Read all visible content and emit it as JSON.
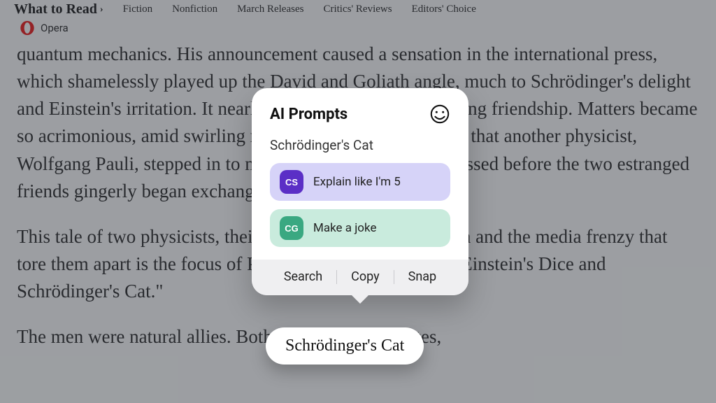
{
  "nav": {
    "brand": "What to Read",
    "items": [
      "Fiction",
      "Nonfiction",
      "March Releases",
      "Critics' Reviews",
      "Editors' Choice"
    ]
  },
  "browser": {
    "name": "Opera"
  },
  "article": {
    "p1": "quantum mechanics. His announcement caused a sensation in the international press, which shamelessly played up the David and Goliath angle, much to Schrödinger's delight and Einstein's irritation. It nearly destroyed their decades-long friendship. Matters became so acrimonious, amid swirling rumors of potential lawsuits, that another physicist, Wolfgang Pauli, stepped in to mediate. A full three years passed before the two estranged friends gingerly began exchanging letters again.",
    "p2": "This tale of two physicists, their shared quest for unification and the media frenzy that tore them apart is the focus of Paul Halpern's latest book, \"Einstein's Dice and Schrödinger's Cat.\"",
    "p3": "The men were natural allies. Both were Nobel laureates,"
  },
  "popover": {
    "title": "AI Prompts",
    "selected_text": "Schrödinger's Cat",
    "prompts": [
      {
        "badge": "CS",
        "label": "Explain like I'm 5",
        "variant": "purple"
      },
      {
        "badge": "CG",
        "label": "Make a joke",
        "variant": "green"
      }
    ],
    "actions": {
      "search": "Search",
      "copy": "Copy",
      "snap": "Snap"
    }
  },
  "selection_pill": "Schrödinger's Cat"
}
